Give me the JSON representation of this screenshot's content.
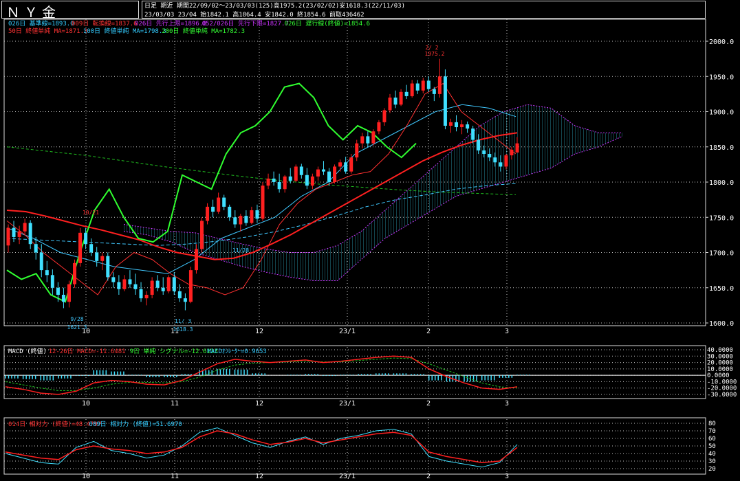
{
  "header": {
    "title": "ＮＹ金",
    "period_label": "日足  期近",
    "period_info": "期間22/09/02～23/03/03(125)高1975.2(23/02/02)安1618.3(22/11/03)",
    "ohlc_date": "23/03/03 23/04",
    "ohlc_values": "始1842.1 高1864.4 安1842.0 終1854.6 前取436462"
  },
  "main_legend": {
    "row1": [
      {
        "text": "026日 基準線=1893.0",
        "color": "#33ccff"
      },
      {
        "text": "009日 転換線=1837.6",
        "color": "#ff3333"
      },
      {
        "text": "026日 先行上限=1896.8",
        "color": "#cc33ff"
      },
      {
        "text": "052/026日 先行下限=1827.7",
        "color": "#cc33ff"
      },
      {
        "text": "026日 遅行線(終値)=1854.6",
        "color": "#33ff33"
      }
    ],
    "row2": [
      {
        "text": "50日 終値単純 MA=1871.3",
        "color": "#ff3333"
      },
      {
        "text": "100日 終値単純 MA=1798.3",
        "color": "#33ccff"
      },
      {
        "text": "200日 終値単純 MA=1782.3",
        "color": "#33ff33"
      }
    ]
  },
  "price_axis": [
    "2000.0",
    "1950.0",
    "1900.0",
    "1850.0",
    "1800.0",
    "1750.0",
    "1700.0",
    "1650.0",
    "1600.0"
  ],
  "x_axis": [
    "10",
    "11",
    "12",
    "23/1",
    "2",
    "3"
  ],
  "annotations": {
    "high_date": "2/ 2",
    "high_value": "1975.2",
    "low1_date": "9/28",
    "low1_value": "1621.3",
    "low2_date": "11/ 3",
    "low2_value": "1618.3",
    "mark_1021": "10/21",
    "mark_1128": "11/28"
  },
  "macd": {
    "legend": [
      {
        "text": "MACD (終値)",
        "color": "#ffffff"
      },
      {
        "text": "12-26日 MACD=-11.6481",
        "color": "#ff3333"
      },
      {
        "text": "9日 単純 シグナル=-12.6133",
        "color": "#33ff33"
      },
      {
        "text": "MACDｵｼﾚｰﾀｰ=0.9653",
        "color": "#33ccff"
      }
    ],
    "axis": [
      "40.0000",
      "30.0000",
      "20.0000",
      "10.0000",
      "0.0000",
      "-10.0000",
      "-20.0000",
      "-30.0000"
    ]
  },
  "rsi": {
    "legend": [
      {
        "text": "014日 相対力 (終値)=48.4797",
        "color": "#ff3333"
      },
      {
        "text": "009日 相対力 (終値)=51.6970",
        "color": "#33ccff"
      }
    ],
    "axis": [
      "80",
      "70",
      "60",
      "50",
      "40",
      "30",
      "20"
    ]
  },
  "colors": {
    "background": "#000000",
    "grid": "#c8c8c8",
    "up": "#ff2020",
    "down": "#40e0ff",
    "ma50": "#ff2020",
    "ma100": "#40c8ff",
    "ma200": "#20c020",
    "lagging": "#30ff30",
    "cloud": "#cc33ff",
    "conversion": "#ff3030",
    "base": "#40c8ff"
  },
  "chart_data": {
    "type": "candlestick",
    "title": "ＮＹ金",
    "y_range": [
      1600,
      2000
    ],
    "categories": [
      "10",
      "11",
      "12",
      "23/1",
      "2",
      "3"
    ],
    "x_start_day": 0,
    "x_end_day": 124,
    "category_positions": [
      21,
      43,
      66,
      87,
      107,
      127
    ],
    "ohlc": [
      [
        1710,
        1740,
        1700,
        1735
      ],
      [
        1735,
        1745,
        1715,
        1722
      ],
      [
        1722,
        1738,
        1712,
        1730
      ],
      [
        1730,
        1748,
        1725,
        1742
      ],
      [
        1742,
        1746,
        1705,
        1712
      ],
      [
        1712,
        1722,
        1690,
        1700
      ],
      [
        1700,
        1712,
        1665,
        1675
      ],
      [
        1675,
        1688,
        1658,
        1668
      ],
      [
        1668,
        1676,
        1640,
        1650
      ],
      [
        1650,
        1658,
        1630,
        1640
      ],
      [
        1640,
        1650,
        1621,
        1630
      ],
      [
        1630,
        1660,
        1622,
        1655
      ],
      [
        1655,
        1690,
        1650,
        1685
      ],
      [
        1685,
        1735,
        1680,
        1728
      ],
      [
        1728,
        1735,
        1705,
        1712
      ],
      [
        1712,
        1720,
        1695,
        1700
      ],
      [
        1700,
        1708,
        1680,
        1688
      ],
      [
        1688,
        1700,
        1675,
        1695
      ],
      [
        1695,
        1700,
        1660,
        1665
      ],
      [
        1665,
        1672,
        1650,
        1658
      ],
      [
        1658,
        1668,
        1640,
        1648
      ],
      [
        1648,
        1668,
        1645,
        1662
      ],
      [
        1662,
        1675,
        1650,
        1655
      ],
      [
        1655,
        1670,
        1640,
        1648
      ],
      [
        1648,
        1658,
        1630,
        1635
      ],
      [
        1635,
        1645,
        1625,
        1640
      ],
      [
        1640,
        1665,
        1635,
        1660
      ],
      [
        1660,
        1668,
        1645,
        1650
      ],
      [
        1650,
        1665,
        1640,
        1645
      ],
      [
        1645,
        1668,
        1642,
        1665
      ],
      [
        1665,
        1672,
        1640,
        1645
      ],
      [
        1645,
        1655,
        1630,
        1635
      ],
      [
        1635,
        1642,
        1618,
        1630
      ],
      [
        1630,
        1680,
        1628,
        1675
      ],
      [
        1675,
        1712,
        1670,
        1705
      ],
      [
        1705,
        1750,
        1700,
        1745
      ],
      [
        1745,
        1770,
        1740,
        1765
      ],
      [
        1765,
        1775,
        1750,
        1758
      ],
      [
        1758,
        1785,
        1755,
        1778
      ],
      [
        1778,
        1782,
        1760,
        1765
      ],
      [
        1765,
        1768,
        1745,
        1750
      ],
      [
        1750,
        1760,
        1735,
        1740
      ],
      [
        1740,
        1755,
        1730,
        1752
      ],
      [
        1752,
        1760,
        1738,
        1742
      ],
      [
        1742,
        1765,
        1740,
        1760
      ],
      [
        1760,
        1768,
        1742,
        1748
      ],
      [
        1748,
        1800,
        1745,
        1795
      ],
      [
        1795,
        1812,
        1790,
        1805
      ],
      [
        1805,
        1815,
        1795,
        1800
      ],
      [
        1800,
        1812,
        1785,
        1790
      ],
      [
        1790,
        1810,
        1785,
        1808
      ],
      [
        1808,
        1820,
        1798,
        1802
      ],
      [
        1802,
        1825,
        1800,
        1822
      ],
      [
        1822,
        1826,
        1805,
        1810
      ],
      [
        1810,
        1820,
        1790,
        1795
      ],
      [
        1795,
        1812,
        1790,
        1808
      ],
      [
        1808,
        1822,
        1802,
        1818
      ],
      [
        1818,
        1830,
        1810,
        1815
      ],
      [
        1815,
        1820,
        1795,
        1800
      ],
      [
        1800,
        1825,
        1798,
        1822
      ],
      [
        1822,
        1832,
        1815,
        1828
      ],
      [
        1828,
        1836,
        1812,
        1815
      ],
      [
        1815,
        1840,
        1812,
        1835
      ],
      [
        1835,
        1860,
        1830,
        1855
      ],
      [
        1855,
        1870,
        1848,
        1865
      ],
      [
        1865,
        1872,
        1850,
        1855
      ],
      [
        1855,
        1875,
        1852,
        1872
      ],
      [
        1872,
        1888,
        1868,
        1885
      ],
      [
        1885,
        1905,
        1880,
        1902
      ],
      [
        1902,
        1925,
        1898,
        1920
      ],
      [
        1920,
        1930,
        1905,
        1910
      ],
      [
        1910,
        1932,
        1908,
        1928
      ],
      [
        1928,
        1938,
        1918,
        1922
      ],
      [
        1922,
        1945,
        1920,
        1940
      ],
      [
        1940,
        1945,
        1925,
        1930
      ],
      [
        1930,
        1948,
        1926,
        1944
      ],
      [
        1944,
        1950,
        1928,
        1932
      ],
      [
        1932,
        1935,
        1915,
        1925
      ],
      [
        1925,
        1975,
        1920,
        1950
      ],
      [
        1950,
        1960,
        1875,
        1880
      ],
      [
        1880,
        1890,
        1870,
        1885
      ],
      [
        1885,
        1895,
        1872,
        1878
      ],
      [
        1878,
        1888,
        1868,
        1882
      ],
      [
        1882,
        1886,
        1870,
        1876
      ],
      [
        1876,
        1880,
        1855,
        1860
      ],
      [
        1860,
        1868,
        1840,
        1845
      ],
      [
        1845,
        1852,
        1835,
        1840
      ],
      [
        1840,
        1848,
        1830,
        1835
      ],
      [
        1835,
        1842,
        1822,
        1828
      ],
      [
        1828,
        1838,
        1815,
        1822
      ],
      [
        1822,
        1840,
        1818,
        1838
      ],
      [
        1838,
        1850,
        1832,
        1846
      ],
      [
        1842,
        1864,
        1842,
        1855
      ]
    ],
    "ohlc_x_days": [
      0,
      2,
      4,
      6,
      8,
      10,
      12,
      14,
      16,
      18,
      20,
      22,
      24,
      26,
      28,
      30,
      32,
      34,
      36,
      38,
      40,
      42,
      44,
      46,
      48,
      50,
      52,
      54,
      56,
      58,
      60,
      62,
      64,
      66,
      68,
      70,
      72,
      74,
      76,
      78,
      80,
      82,
      84,
      86,
      88,
      90,
      92,
      94,
      96,
      98,
      100,
      102,
      104,
      106,
      108,
      110,
      112,
      114,
      116,
      118,
      120,
      122,
      124,
      126,
      128,
      130,
      132,
      134,
      136,
      138,
      140,
      142,
      144,
      146,
      148,
      150,
      152,
      154,
      156,
      158,
      160,
      162,
      164,
      166,
      168,
      170,
      172,
      174,
      176,
      178,
      180,
      182,
      184
    ],
    "series": [
      {
        "name": "50日 終値単純 MA",
        "values": [
          1760,
          1758,
          1752,
          1745,
          1738,
          1732,
          1725,
          1718,
          1708,
          1700,
          1695,
          1690,
          1692,
          1700,
          1712,
          1725,
          1740,
          1755,
          1770,
          1785,
          1800,
          1815,
          1830,
          1842,
          1852,
          1860,
          1866,
          1870
        ]
      },
      {
        "name": "100日 終値単純 MA",
        "values": [
          1720,
          1718,
          1716,
          1714,
          1712,
          1710,
          1712,
          1716,
          1722,
          1730,
          1740,
          1752,
          1765,
          1775,
          1782,
          1790,
          1795,
          1798
        ]
      },
      {
        "name": "200日 終値単純 MA",
        "values": [
          1850,
          1844,
          1838,
          1830,
          1822,
          1815,
          1808,
          1802,
          1797,
          1793,
          1789,
          1786,
          1784,
          1782
        ]
      },
      {
        "name": "026日 遅行線(終値)",
        "values": [
          1675,
          1662,
          1670,
          1640,
          1630,
          1700,
          1760,
          1790,
          1750,
          1720,
          1715,
          1730,
          1810,
          1800,
          1790,
          1840,
          1870,
          1880,
          1900,
          1935,
          1940,
          1920,
          1880,
          1860,
          1880,
          1870,
          1850,
          1835,
          1855
        ]
      },
      {
        "name": "009日 転換線",
        "values": [
          1745,
          1725,
          1700,
          1680,
          1660,
          1640,
          1680,
          1700,
          1690,
          1670,
          1655,
          1650,
          1640,
          1650,
          1690,
          1740,
          1770,
          1790,
          1800,
          1810,
          1815,
          1840,
          1880,
          1925,
          1940,
          1900,
          1880,
          1860,
          1840
        ]
      },
      {
        "name": "026日 基準線",
        "values": [
          1735,
          1720,
          1700,
          1690,
          1680,
          1675,
          1670,
          1690,
          1720,
          1735,
          1750,
          1780,
          1800,
          1840,
          1860,
          1880,
          1900,
          1910,
          1905,
          1893
        ]
      }
    ],
    "cloud": {
      "upper": [
        1740,
        1735,
        1730,
        1728,
        1720,
        1712,
        1705,
        1700,
        1700,
        1710,
        1730,
        1760,
        1790,
        1820,
        1850,
        1880,
        1900,
        1910,
        1905,
        1880,
        1870,
        1870
      ],
      "lower": [
        1730,
        1725,
        1715,
        1700,
        1690,
        1680,
        1672,
        1665,
        1660,
        1660,
        1690,
        1720,
        1740,
        1760,
        1780,
        1790,
        1800,
        1810,
        1820,
        1840,
        1850,
        1865
      ]
    },
    "macd_series": {
      "macd": [
        -18,
        -22,
        -28,
        -30,
        -25,
        -12,
        -8,
        -10,
        -14,
        -15,
        -8,
        5,
        18,
        25,
        22,
        20,
        22,
        24,
        20,
        22,
        25,
        28,
        30,
        28,
        10,
        -2,
        -12,
        -20,
        -22,
        -18
      ],
      "signal": [
        -10,
        -15,
        -20,
        -24,
        -24,
        -20,
        -14,
        -11,
        -11,
        -12,
        -10,
        -3,
        8,
        16,
        19,
        20,
        21,
        22,
        21,
        21,
        23,
        25,
        27,
        26,
        18,
        8,
        -2,
        -12,
        -18,
        -20
      ],
      "oscillator": [
        -5,
        -6,
        -8,
        -5,
        -1,
        8,
        6,
        1,
        -3,
        -3,
        2,
        8,
        10,
        9,
        3,
        0,
        1,
        2,
        -1,
        1,
        2,
        3,
        3,
        2,
        -8,
        -10,
        -10,
        -8,
        -4,
        1
      ]
    },
    "rsi_series": {
      "rsi14": [
        42,
        38,
        34,
        32,
        45,
        50,
        46,
        44,
        40,
        42,
        48,
        62,
        70,
        66,
        58,
        52,
        55,
        60,
        54,
        58,
        62,
        66,
        68,
        64,
        42,
        36,
        32,
        28,
        30,
        48
      ],
      "rsi9": [
        40,
        34,
        28,
        26,
        48,
        56,
        44,
        40,
        34,
        38,
        50,
        68,
        74,
        64,
        54,
        48,
        56,
        62,
        52,
        60,
        64,
        70,
        72,
        66,
        36,
        30,
        26,
        22,
        28,
        52
      ]
    }
  }
}
